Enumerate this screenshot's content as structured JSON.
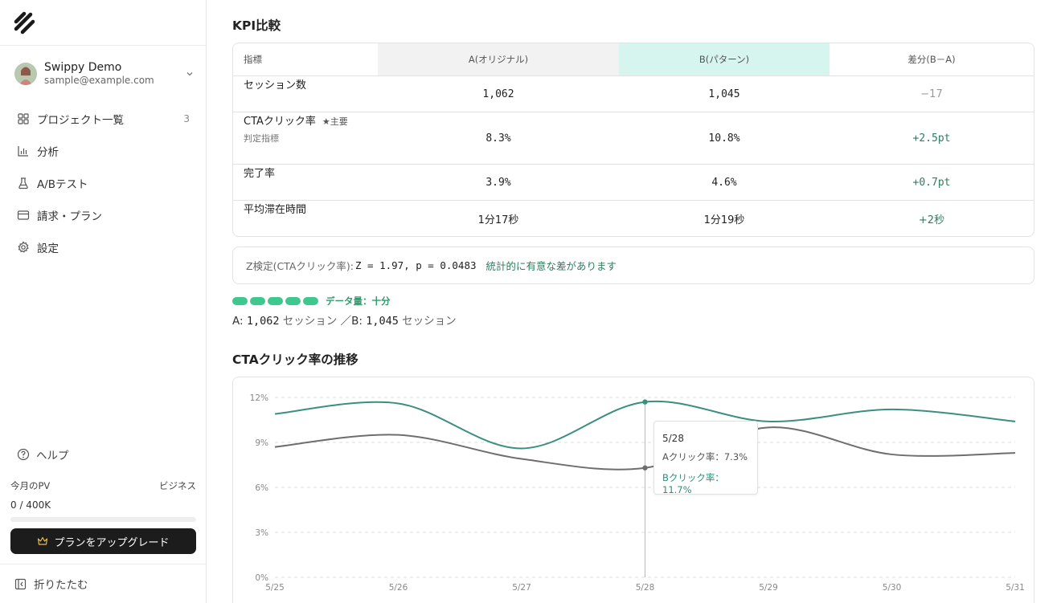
{
  "sidebar": {
    "user": {
      "name": "Swippy Demo",
      "email": "sample@example.com"
    },
    "nav": [
      {
        "label": "プロジェクト一覧",
        "count": "3",
        "icon": "grid-icon"
      },
      {
        "label": "分析",
        "icon": "bar-chart-icon"
      },
      {
        "label": "A/Bテスト",
        "icon": "flask-icon"
      },
      {
        "label": "請求・プラン",
        "icon": "credit-card-icon"
      },
      {
        "label": "設定",
        "icon": "gear-icon"
      }
    ],
    "help": "ヘルプ",
    "pv_label": "今月のPV",
    "plan": "ビジネス",
    "pv_value": "0 / 400K",
    "pv_fraction": 0,
    "upgrade": "プランをアップグレード",
    "collapse": "折りたたむ"
  },
  "kpi": {
    "title": "KPI比較",
    "headers": [
      "指標",
      "A(オリジナル)",
      "B(パターン)",
      "差分(B－A)"
    ],
    "rows": [
      {
        "metric": "セッション数",
        "a": "1,062",
        "b": "1,045",
        "diff": "−17"
      },
      {
        "metric": "CTAクリック率",
        "badge": "★主要",
        "sub": "判定指標",
        "a": "8.3%",
        "b": "10.8%",
        "diff": "+2.5pt"
      },
      {
        "metric": "完了率",
        "a": "3.9%",
        "b": "4.6%",
        "diff": "+0.7pt"
      },
      {
        "metric": "平均滞在時間",
        "a": "1分17秒",
        "b": "1分19秒",
        "diff": "+2秒"
      }
    ]
  },
  "ztest": {
    "label": "Z検定(CTAクリック率):",
    "value": "Z = 1.97, p = 0.0483",
    "result": "統計的に有意な差があります"
  },
  "data_quality": {
    "label": "データ量：十分",
    "sessions_a_label": "A:",
    "sessions_a": "1,062",
    "sessions_b_label": "／B:",
    "sessions_b": "1,045",
    "unit": "セッション"
  },
  "chart_title": "CTAクリック率の推移",
  "chart_data": {
    "type": "line",
    "x": [
      "5/25",
      "5/26",
      "5/27",
      "5/28",
      "5/29",
      "5/30",
      "5/31"
    ],
    "yticks": [
      "12%",
      "9%",
      "6%",
      "3%",
      "0%"
    ],
    "ylim": [
      0,
      12
    ],
    "series": [
      {
        "name": "A",
        "values": [
          8.7,
          9.5,
          7.9,
          7.3,
          10.0,
          8.2,
          8.3
        ],
        "color": "#6e6e6e"
      },
      {
        "name": "B",
        "values": [
          10.9,
          11.6,
          8.6,
          11.7,
          10.4,
          11.2,
          10.4
        ],
        "color": "#3a8f80"
      }
    ],
    "grid": true
  },
  "tooltip": {
    "date": "5/28",
    "a": "Aクリック率：7.3%",
    "b": "Bクリック率：11.7%"
  }
}
